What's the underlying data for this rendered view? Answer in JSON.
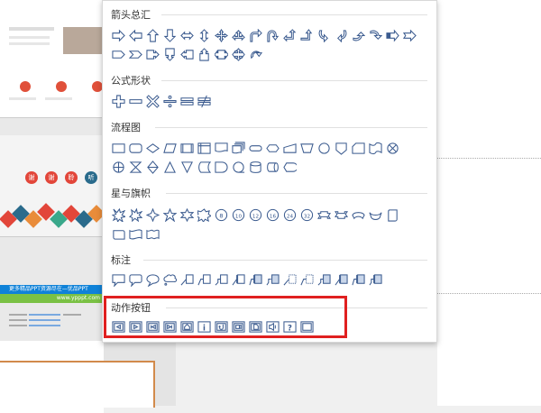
{
  "sections": [
    {
      "title": "箭头总汇",
      "key": "arrows"
    },
    {
      "title": "公式形状",
      "key": "formula"
    },
    {
      "title": "流程图",
      "key": "flowchart"
    },
    {
      "title": "星与旗帜",
      "key": "stars"
    },
    {
      "title": "标注",
      "key": "callouts"
    },
    {
      "title": "动作按钮",
      "key": "actions"
    }
  ],
  "star_labels": [
    "8",
    "10",
    "12",
    "16",
    "24",
    "32"
  ],
  "action_help_label": "?",
  "action_info_label": "i",
  "thumb_banner_text": "更多精品PPT资源尽在—优品PPT",
  "thumb_banner_url": "www.ypppt.com",
  "thumb_circles": [
    "谢",
    "谢",
    "聆",
    "听"
  ],
  "colors": {
    "icon_stroke": "#3b5b8f",
    "highlight": "#e02020",
    "banner_blue": "#0f82d8",
    "banner_green": "#7ac144"
  }
}
